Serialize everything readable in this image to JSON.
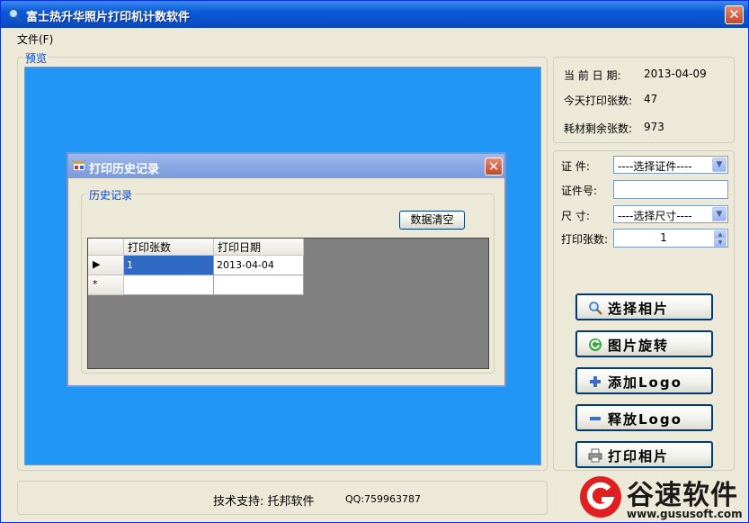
{
  "window": {
    "title": "富士热升华照片打印机计数软件"
  },
  "menu": {
    "file": "文件(F)"
  },
  "preview": {
    "label": "预览"
  },
  "info": {
    "date_label": "当 前 日 期:",
    "date_value": "2013-04-09",
    "today_label": "今天打印张数:",
    "today_value": "47",
    "remain_label": "耗材剩余张数:",
    "remain_value": "973"
  },
  "form": {
    "cert_label": "证   件:",
    "cert_value": "----选择证件----",
    "certno_label": "证件号:",
    "size_label": "尺   寸:",
    "size_value": "----选择尺寸----",
    "count_label": "打印张数:",
    "count_value": "1"
  },
  "buttons": {
    "select_photo": "选择相片",
    "rotate": "图片旋转",
    "add_logo": "添加Logo",
    "release_logo": "释放Logo",
    "print": "打印相片"
  },
  "status": {
    "support": "技术支持: 托邦软件",
    "qq": "QQ:759963787"
  },
  "dialog": {
    "title": "打印历史记录",
    "group_label": "历史记录",
    "clear_button": "数据清空",
    "columns": [
      "打印张数",
      "打印日期"
    ],
    "rows": [
      {
        "count": "1",
        "date": "2013-04-04"
      }
    ],
    "new_row_marker": "*"
  },
  "watermark": {
    "brand": "谷速软件",
    "url": "www.gususoft.com"
  },
  "colors": {
    "preview_bg": "#2196f5",
    "title_bar": "#0a5ad8",
    "selected_cell": "#316ac5"
  },
  "icons": {
    "app": "search-icon",
    "select_photo": "magnifier-icon",
    "rotate": "rotate-icon",
    "add_logo": "plus-icon",
    "release_logo": "minus-icon",
    "print": "printer-icon"
  }
}
